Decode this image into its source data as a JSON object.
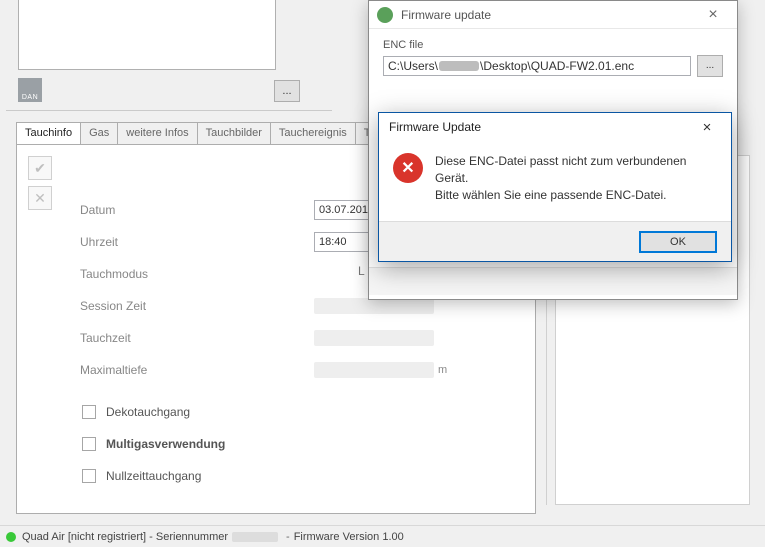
{
  "topButtons": {
    "dots": "..."
  },
  "tabs": [
    "Tauchinfo",
    "Gas",
    "weitere Infos",
    "Tauchbilder",
    "Tauchereignis",
    "Tauch"
  ],
  "activeTab": "Tauchinfo",
  "form": {
    "datum": {
      "label": "Datum",
      "value": "03.07.201"
    },
    "uhrzeit": {
      "label": "Uhrzeit",
      "value": "18:40"
    },
    "tauchmodus": {
      "label": "Tauchmodus"
    },
    "sessionZeit": {
      "label": "Session Zeit"
    },
    "tauchzeit": {
      "label": "Tauchzeit"
    },
    "maximaltiefe": {
      "label": "Maximaltiefe",
      "unit": "m"
    },
    "L": "L",
    "checkboxes": [
      {
        "label": "Dekotauchgang",
        "checked": false
      },
      {
        "label": "Multigasverwendung",
        "checked": false
      },
      {
        "label": "Nullzeittauchgang",
        "checked": false
      }
    ]
  },
  "firmwareWindow": {
    "title": "Firmware update",
    "groupLabel": "ENC file",
    "pathPrefix": "C:\\Users\\",
    "pathSuffix": "\\Desktop\\QUAD-FW2.01.enc",
    "browse": "..."
  },
  "alert": {
    "title": "Firmware Update",
    "line1": "Diese ENC-Datei passt nicht zum verbundenen Gerät.",
    "line2": "Bitte wählen Sie eine passende ENC-Datei.",
    "ok": "OK"
  },
  "status": {
    "pre": "Quad Air [nicht registriert] - Seriennummer",
    "post": "Firmware Version 1.00"
  }
}
